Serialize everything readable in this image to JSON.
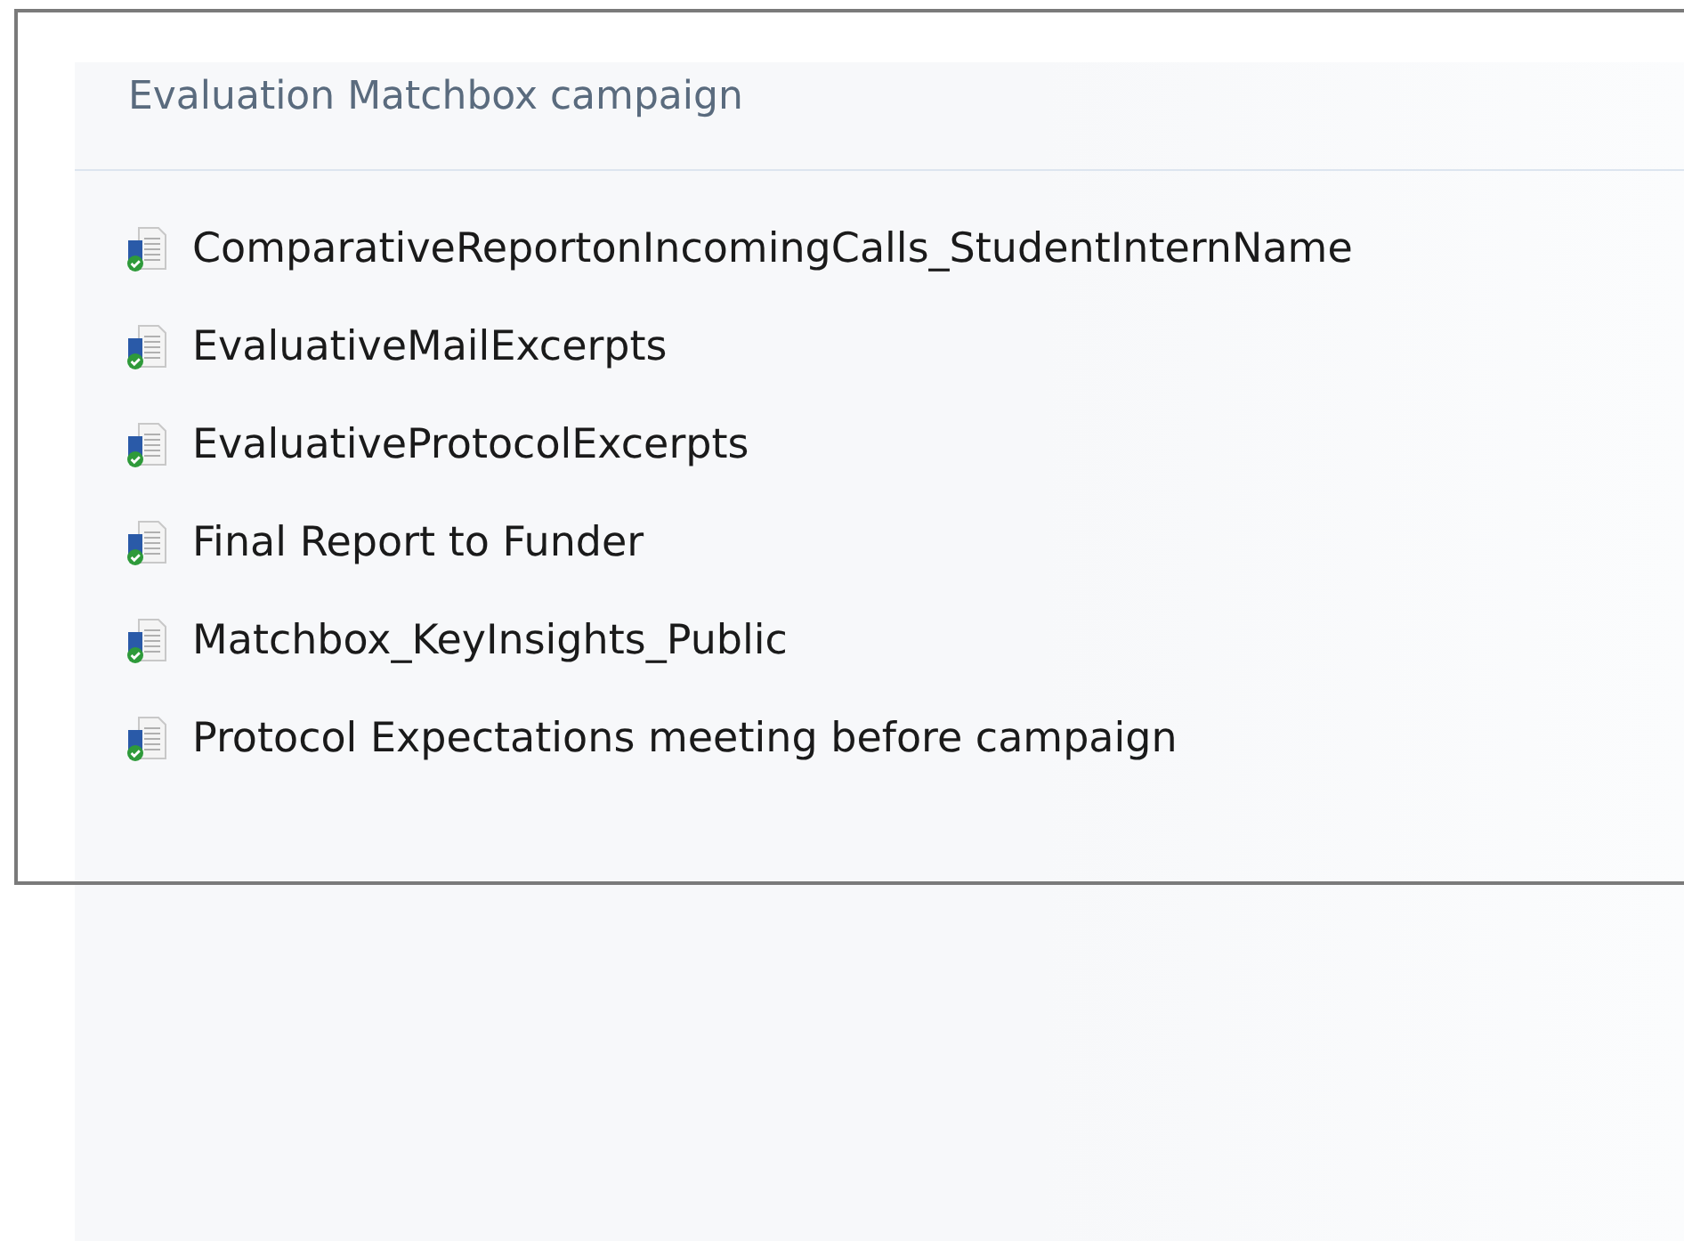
{
  "group": {
    "title": "Evaluation Matchbox campaign",
    "items": [
      {
        "label": "ComparativeReportonIncomingCalls_StudentInternName"
      },
      {
        "label": "EvaluativeMailExcerpts"
      },
      {
        "label": "EvaluativeProtocolExcerpts"
      },
      {
        "label": "Final Report to Funder"
      },
      {
        "label": "Matchbox_KeyInsights_Public"
      },
      {
        "label": "Protocol Expectations meeting before campaign"
      }
    ]
  }
}
